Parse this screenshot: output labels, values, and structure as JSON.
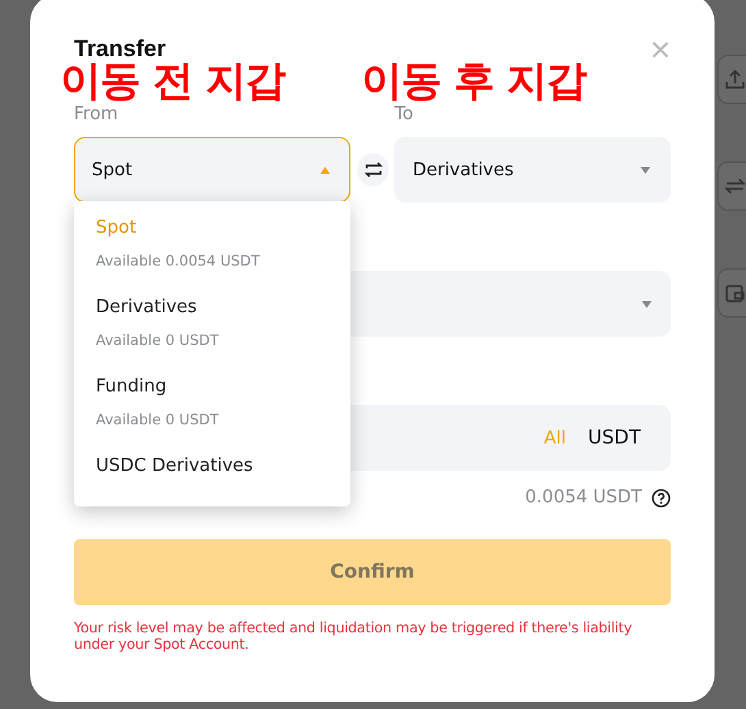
{
  "dialog": {
    "title": "Transfer",
    "close": "×"
  },
  "annotations": [
    {
      "text": "이동 전 지갑"
    },
    {
      "text": "이동 후 지갑"
    }
  ],
  "from": {
    "label": "From",
    "value": "Spot",
    "expanded": true
  },
  "to": {
    "label": "To",
    "value": "Derivatives",
    "expanded": false
  },
  "dropdown": [
    {
      "name": "Spot",
      "available": "Available 0.0054 USDT",
      "selected": true
    },
    {
      "name": "Derivatives",
      "available": "Available 0 USDT",
      "selected": false
    },
    {
      "name": "Funding",
      "available": "Available 0 USDT",
      "selected": false
    },
    {
      "name": "USDC Derivatives",
      "selected": false
    }
  ],
  "amount": {
    "all": "All",
    "unit": "USDT",
    "available": "0.0054 USDT"
  },
  "confirm": {
    "label": "Confirm",
    "disabled": true
  },
  "warning": "Your risk level may be affected and liquidation may be triggered if there's liability under your Spot Account."
}
